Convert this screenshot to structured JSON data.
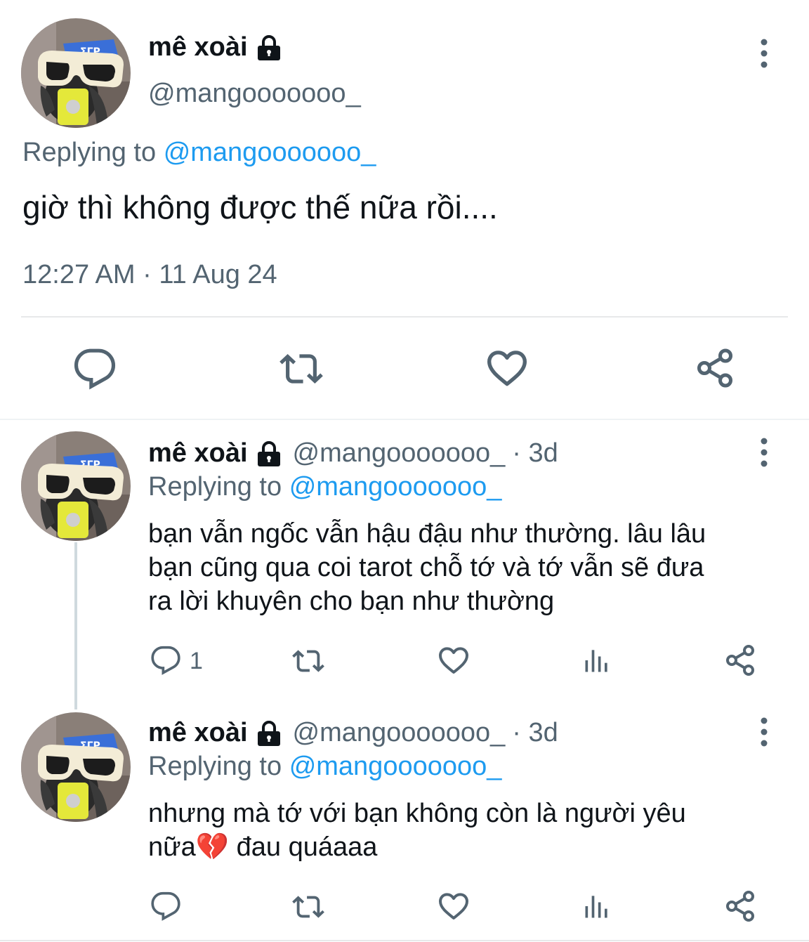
{
  "main_tweet": {
    "display_name": "mê xoài",
    "handle": "@mangooooooo_",
    "replying_prefix": "Replying to",
    "replying_handle": "@mangooooooo_",
    "text": "giờ thì không được thế nữa rồi....",
    "timestamp": "12:27 AM · 11 Aug 24",
    "actions": [
      "reply-icon",
      "retweet-icon",
      "like-icon",
      "share-icon"
    ]
  },
  "replies": [
    {
      "display_name": "mê xoài",
      "handle": "@mangooooooo_",
      "time": "· 3d",
      "replying_prefix": "Replying to",
      "replying_handle": "@mangooooooo_",
      "text_lines": [
        "bạn vẫn ngốc vẫn hậu đậu như thường. lâu lâu",
        "bạn cũng qua coi tarot chỗ tớ và tớ vẫn sẽ đưa",
        "ra lời khuyên cho bạn như thường"
      ],
      "reply_count": "1"
    },
    {
      "display_name": "mê xoài",
      "handle": "@mangooooooo_",
      "time": "· 3d",
      "replying_prefix": "Replying to",
      "replying_handle": "@mangooooooo_",
      "text_line1": "nhưng mà tớ với bạn không còn là người yêu",
      "text_line2_start": "nữa",
      "emoji": "💔",
      "text_line2_end": " đau quáaaa"
    }
  ],
  "colors": {
    "text": "#0f1419",
    "secondary": "#536471",
    "accent": "#1d9bf0",
    "divider": "#e7e9ea"
  }
}
